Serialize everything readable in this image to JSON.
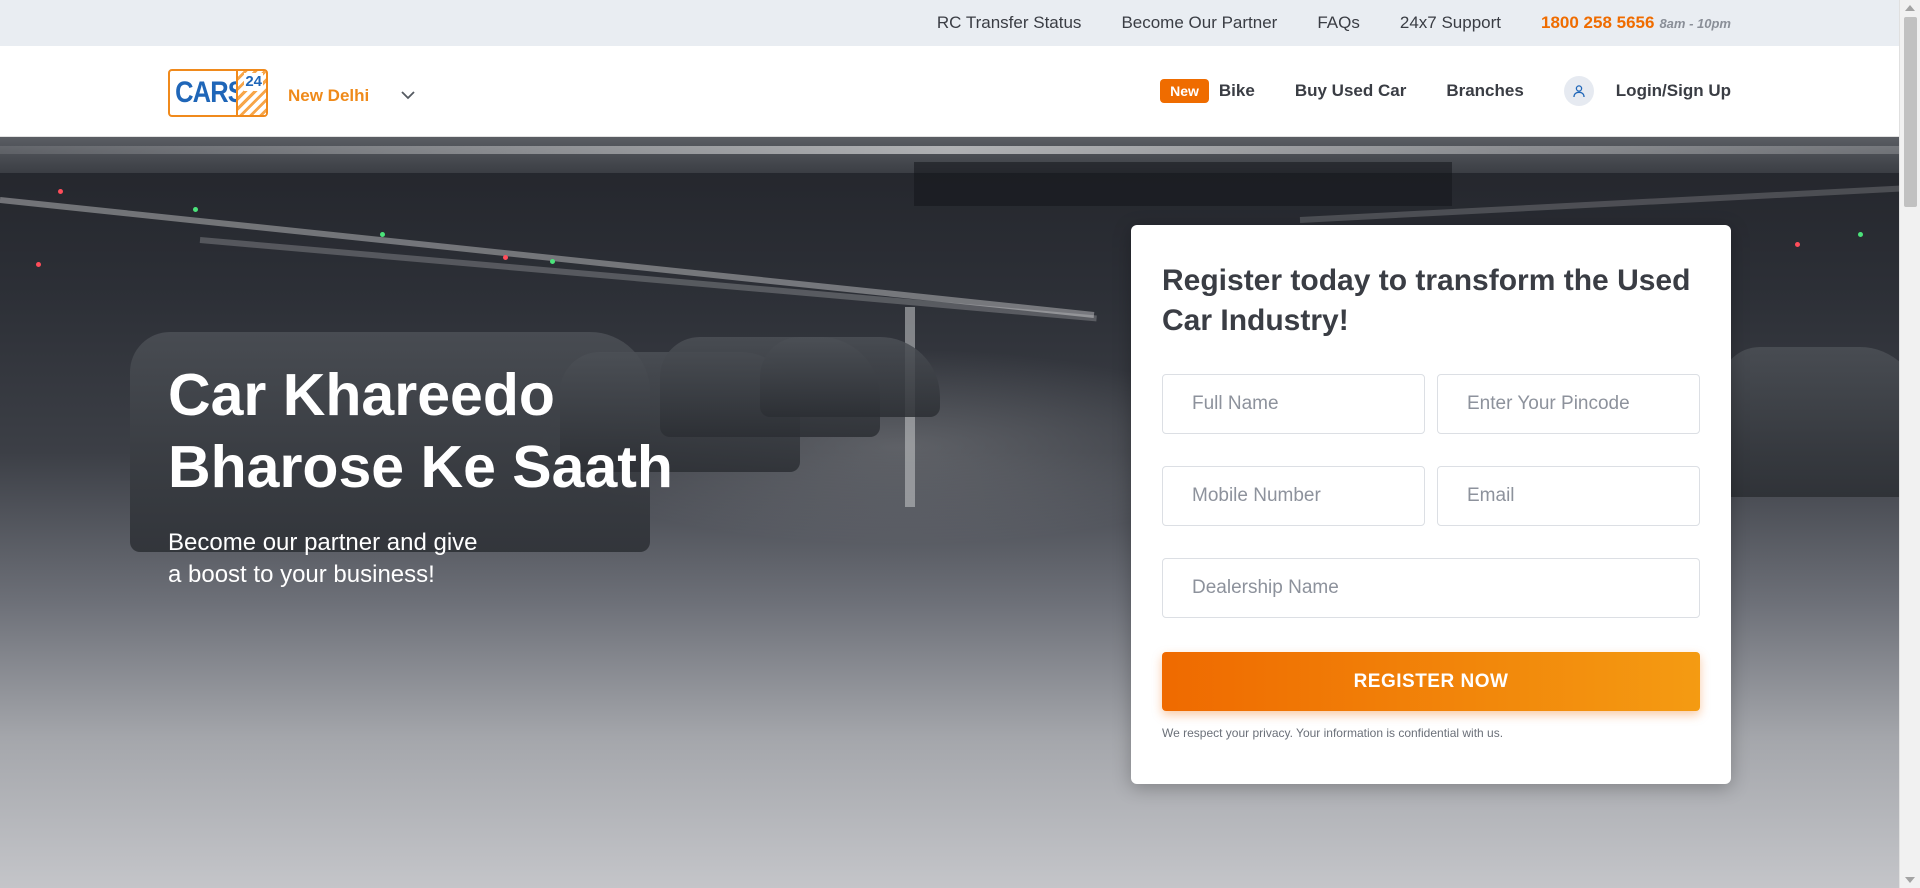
{
  "topbar": {
    "links": [
      "RC Transfer Status",
      "Become Our Partner",
      "FAQs",
      "24x7 Support"
    ],
    "phone": "1800 258 5656",
    "hours": "8am - 10pm"
  },
  "header": {
    "logo_text": "CARS",
    "logo_number": "24",
    "city": "New Delhi",
    "nav": {
      "new_badge": "New",
      "bike": "Bike",
      "buy_used_car": "Buy Used Car",
      "branches": "Branches",
      "login": "Login/Sign Up"
    }
  },
  "hero": {
    "title_line1": "Car Khareedo",
    "title_line2": "Bharose Ke Saath",
    "subtitle_line1": "Become our partner and give",
    "subtitle_line2": "a boost to your business!"
  },
  "form": {
    "title": "Register today to transform the Used Car Industry!",
    "full_name": {
      "placeholder": "Full Name",
      "value": ""
    },
    "pincode": {
      "placeholder": "Enter Your Pincode",
      "value": ""
    },
    "mobile": {
      "placeholder": "Mobile Number",
      "value": ""
    },
    "email": {
      "placeholder": "Email",
      "value": ""
    },
    "dealership": {
      "placeholder": "Dealership Name",
      "value": ""
    },
    "submit_label": "REGISTER NOW",
    "privacy": "We respect your privacy. Your information is confidential with us."
  },
  "colors": {
    "accent": "#ef6c00",
    "brand_blue": "#1f66b8",
    "text_dark": "#3a3d44"
  }
}
